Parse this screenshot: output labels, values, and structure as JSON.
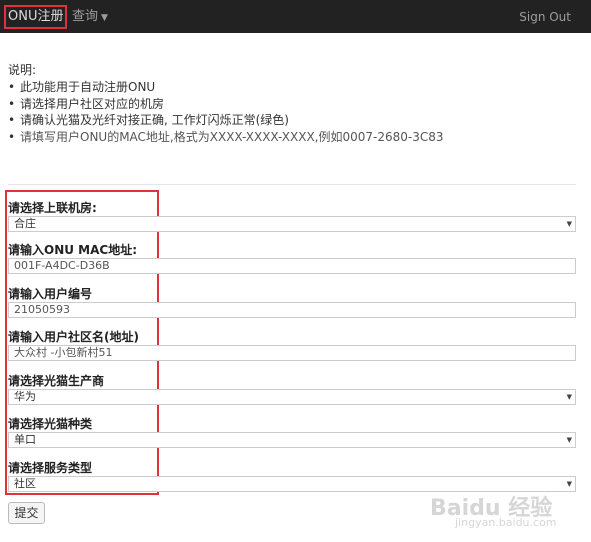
{
  "navbar": {
    "brand": "ONU注册",
    "query": "查询",
    "signout": "Sign Out"
  },
  "description": {
    "title": "说明:",
    "items": [
      "此功能用于自动注册ONU",
      "请选择用户社区对应的机房",
      "请确认光猫及光纤对接正确, 工作灯闪烁正常(绿色)",
      "请填写用户ONU的MAC地址,格式为XXXX-XXXX-XXXX,例如0007-2680-3C83"
    ]
  },
  "form": {
    "room": {
      "label": "请选择上联机房:",
      "value": "合庄"
    },
    "mac": {
      "label": "请输入ONU MAC地址:",
      "value": "001F-A4DC-D36B"
    },
    "user_id": {
      "label": "请输入用户编号",
      "value": "21050593"
    },
    "community": {
      "label": "请输入用户社区名(地址)",
      "value": "大众村 -小包新村51"
    },
    "vendor": {
      "label": "请选择光猫生产商",
      "value": "华为"
    },
    "modem_type": {
      "label": "请选择光猫种类",
      "value": "单口"
    },
    "service_type": {
      "label": "请选择服务类型",
      "value": "社区"
    },
    "submit_label": "提交"
  },
  "watermark": {
    "brand": "Baidu 经验",
    "url": "jingyan.baidu.com"
  },
  "colors": {
    "navbar_bg": "#222222",
    "highlight_box": "#e0323a"
  }
}
